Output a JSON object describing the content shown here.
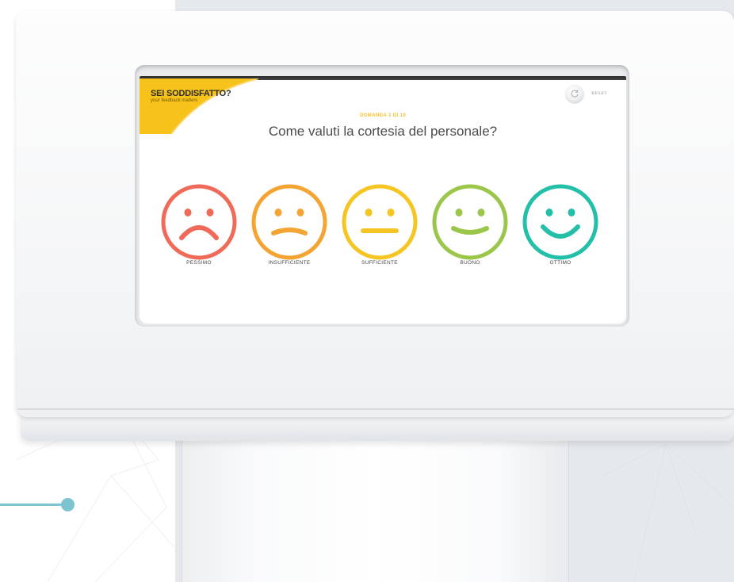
{
  "survey": {
    "brand_title": "SEI SODDISFATTO?",
    "brand_subtitle": "your feedback matters",
    "reset_label": "RESET",
    "question_counter": "DOMANDA 3 DI 10",
    "question_text": "Come valuti la cortesia del personale?",
    "options": [
      {
        "label": "PESSIMO",
        "color": "#f06a5a",
        "mood": "very-sad"
      },
      {
        "label": "INSUFFICIENTE",
        "color": "#f4a432",
        "mood": "sad"
      },
      {
        "label": "SUFFICIENTE",
        "color": "#f5c623",
        "mood": "neutral"
      },
      {
        "label": "BUONO",
        "color": "#9ac649",
        "mood": "happy"
      },
      {
        "label": "OTTIMO",
        "color": "#23bfa8",
        "mood": "very-happy"
      }
    ]
  },
  "colors": {
    "brand_accent": "#f7c31a",
    "decor_line": "#7cc4cf"
  }
}
